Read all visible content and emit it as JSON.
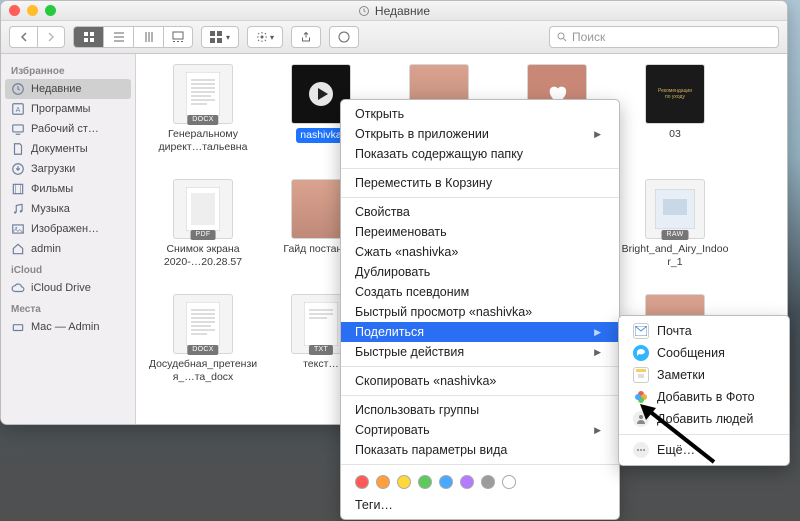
{
  "window": {
    "title": "Недавние"
  },
  "toolbar": {
    "search_placeholder": "Поиск"
  },
  "sidebar": {
    "sections": [
      {
        "header": "Избранное",
        "items": [
          {
            "icon": "clock",
            "label": "Недавние",
            "sel": true
          },
          {
            "icon": "apps",
            "label": "Программы"
          },
          {
            "icon": "desktop",
            "label": "Рабочий ст…"
          },
          {
            "icon": "doc",
            "label": "Документы"
          },
          {
            "icon": "download",
            "label": "Загрузки"
          },
          {
            "icon": "film",
            "label": "Фильмы"
          },
          {
            "icon": "music",
            "label": "Музыка"
          },
          {
            "icon": "image",
            "label": "Изображен…"
          },
          {
            "icon": "home",
            "label": "admin"
          }
        ]
      },
      {
        "header": "iCloud",
        "items": [
          {
            "icon": "cloud",
            "label": "iCloud Drive"
          }
        ]
      },
      {
        "header": "Места",
        "items": [
          {
            "icon": "drive",
            "label": "Mac — Admin"
          }
        ]
      }
    ]
  },
  "files": [
    {
      "thumb": "docx",
      "label": "Генеральному директ…тальевна"
    },
    {
      "thumb": "vid",
      "label": "nashivka",
      "sel": true
    },
    {
      "thumb": "img",
      "label": ""
    },
    {
      "thumb": "heart",
      "label": ""
    },
    {
      "thumb": "dark",
      "label": "03"
    },
    {
      "thumb": "pdf",
      "label": "Снимок экрана 2020-…20.28.57"
    },
    {
      "thumb": "img",
      "label": "Гайд постано…"
    },
    {
      "thumb": "blank",
      "label": ""
    },
    {
      "thumb": "blank",
      "label": ""
    },
    {
      "thumb": "raw",
      "label": "Bright_and_Airy_Indoor_1"
    },
    {
      "thumb": "docx",
      "label": "Досудебная_претензия_…та_docx"
    },
    {
      "thumb": "txt",
      "label": "текст…"
    },
    {
      "thumb": "blank",
      "label": ""
    },
    {
      "thumb": "blank",
      "label": ""
    },
    {
      "thumb": "img",
      "label": ""
    }
  ],
  "context_menu": [
    {
      "label": "Открыть"
    },
    {
      "label": "Открыть в приложении",
      "sub": true
    },
    {
      "label": "Показать содержащую папку"
    },
    {
      "sep": true
    },
    {
      "label": "Переместить в Корзину"
    },
    {
      "sep": true
    },
    {
      "label": "Свойства"
    },
    {
      "label": "Переименовать"
    },
    {
      "label": "Сжать «nashivka»"
    },
    {
      "label": "Дублировать"
    },
    {
      "label": "Создать псевдоним"
    },
    {
      "label": "Быстрый просмотр «nashivka»"
    },
    {
      "label": "Поделиться",
      "sub": true,
      "hl": true
    },
    {
      "label": "Быстрые действия",
      "sub": true
    },
    {
      "sep": true
    },
    {
      "label": "Скопировать «nashivka»"
    },
    {
      "sep": true
    },
    {
      "label": "Использовать группы"
    },
    {
      "label": "Сортировать",
      "sub": true
    },
    {
      "label": "Показать параметры вида"
    },
    {
      "sep": true
    },
    {
      "tags": true
    },
    {
      "label": "Теги…"
    }
  ],
  "share_submenu": [
    {
      "icon": "mail",
      "label": "Почта"
    },
    {
      "icon": "msg",
      "label": "Сообщения"
    },
    {
      "icon": "notes",
      "label": "Заметки"
    },
    {
      "icon": "photos",
      "label": "Добавить в Фото"
    },
    {
      "icon": "people",
      "label": "Добавить людей"
    },
    {
      "sep": true
    },
    {
      "icon": "more",
      "label": "Ещё…"
    }
  ],
  "tag_colors": [
    "#ff5a5a",
    "#ff9f3a",
    "#ffd93a",
    "#5ec95e",
    "#4aa8ff",
    "#b47aff",
    "#9c9c9c"
  ]
}
